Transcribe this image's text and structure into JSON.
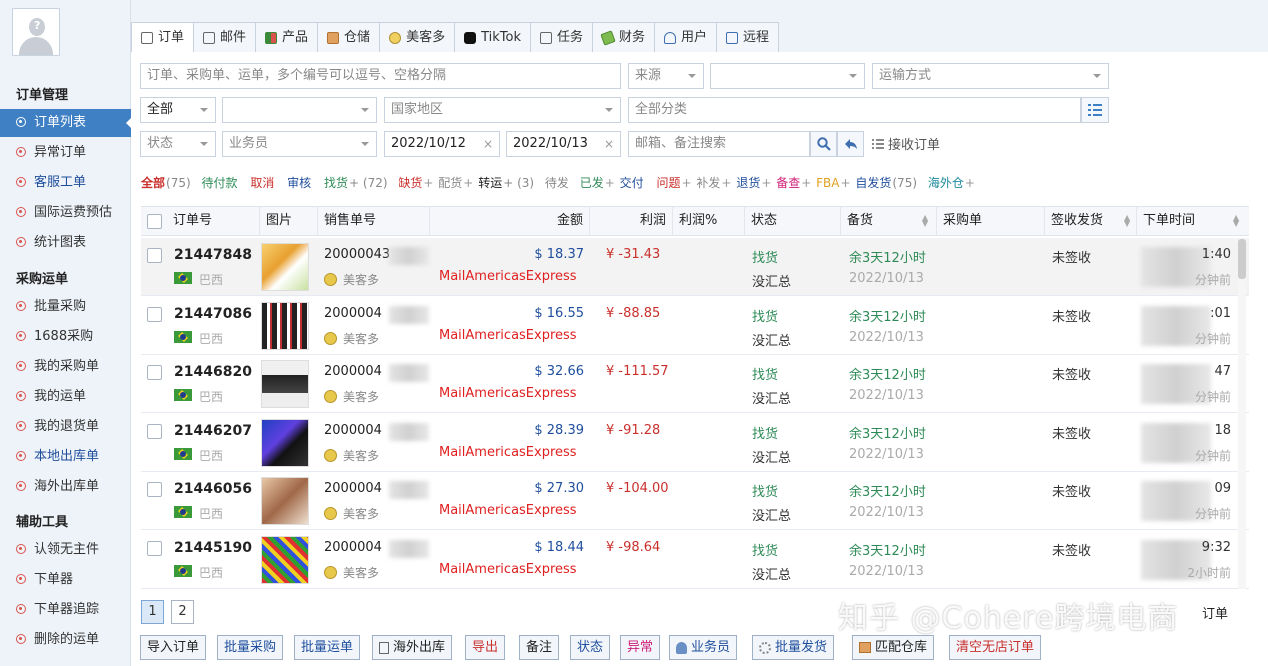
{
  "sidebar": {
    "sections": [
      {
        "title": "订单管理",
        "items": [
          "订单列表",
          "异常订单",
          "客服工单",
          "国际运费预估",
          "统计图表"
        ]
      },
      {
        "title": "采购运单",
        "items": [
          "批量采购",
          "1688采购",
          "我的采购单",
          "我的运单",
          "我的退货单",
          "本地出库单",
          "海外出库单"
        ]
      },
      {
        "title": "辅助工具",
        "items": [
          "认领无主件",
          "下单器",
          "下单器追踪",
          "删除的运单"
        ]
      }
    ]
  },
  "tabs": [
    {
      "label": "订单",
      "icon": "document-icon"
    },
    {
      "label": "邮件",
      "icon": "mail-icon"
    },
    {
      "label": "产品",
      "icon": "grid-icon"
    },
    {
      "label": "仓储",
      "icon": "box-icon"
    },
    {
      "label": "美客多",
      "icon": "handshake-icon"
    },
    {
      "label": "TikTok",
      "icon": "tiktok-icon"
    },
    {
      "label": "任务",
      "icon": "task-icon"
    },
    {
      "label": "财务",
      "icon": "money-icon"
    },
    {
      "label": "用户",
      "icon": "user-icon"
    },
    {
      "label": "远程",
      "icon": "monitor-icon"
    }
  ],
  "filters": {
    "search_placeholder": "订单、采购单、运单，多个编号可以逗号、空格分隔",
    "source": "来源",
    "shipping": "运输方式",
    "all": "全部",
    "country": "国家地区",
    "category": "全部分类",
    "status": "状态",
    "salesman": "业务员",
    "date_from": "2022/10/12",
    "date_to": "2022/10/13",
    "remark_placeholder": "邮箱、备注搜索",
    "receive_orders": "接收订单"
  },
  "status_tabs": {
    "all": "全部",
    "all_count": "(75)",
    "pending_pay": "待付款",
    "cancel": "取消",
    "review": "审核",
    "find_goods": "找货",
    "find_goods_count": "+ (72)",
    "short": "缺货",
    "allocate": "配货",
    "transfer": "转运",
    "transfer_count": "+ (3)",
    "to_ship": "待发",
    "shipped": "已发",
    "delivered": "交付",
    "problem": "问题",
    "reship": "补发",
    "return": "退货",
    "stock": "备查",
    "fba": "FBA",
    "self_ship": "自发货",
    "self_ship_count": "(75)",
    "overseas": "海外仓",
    "plus": "+"
  },
  "table": {
    "headers": [
      "订单号",
      "图片",
      "销售单号",
      "金额",
      "利润",
      "利润%",
      "状态",
      "备货",
      "采购单",
      "签收发货",
      "下单时间"
    ],
    "rows": [
      {
        "id": "21447848",
        "country": "巴西",
        "sale": "20000043",
        "shop": "美客多",
        "carrier": "MailAmericasExpress",
        "amount": "$ 18.37",
        "profit": "¥ -31.43",
        "state": "找货",
        "state2": "没汇总",
        "stock": "余3天12小时",
        "date": "2022/10/13",
        "sign": "未签收",
        "time": "1:40",
        "ago": "分钟前"
      },
      {
        "id": "21447086",
        "country": "巴西",
        "sale": "2000004",
        "shop": "美客多",
        "carrier": "MailAmericasExpress",
        "amount": "$ 16.55",
        "profit": "¥ -88.85",
        "state": "找货",
        "state2": "没汇总",
        "stock": "余3天12小时",
        "date": "2022/10/13",
        "sign": "未签收",
        "time": ":01",
        "ago": "分钟前"
      },
      {
        "id": "21446820",
        "country": "巴西",
        "sale": "2000004",
        "shop": "美客多",
        "carrier": "MailAmericasExpress",
        "amount": "$ 32.66",
        "profit": "¥ -111.57",
        "state": "找货",
        "state2": "没汇总",
        "stock": "余3天12小时",
        "date": "2022/10/13",
        "sign": "未签收",
        "time": "47",
        "ago": "分钟前"
      },
      {
        "id": "21446207",
        "country": "巴西",
        "sale": "2000004",
        "shop": "美客多",
        "carrier": "MailAmericasExpress",
        "amount": "$ 28.39",
        "profit": "¥ -91.28",
        "state": "找货",
        "state2": "没汇总",
        "stock": "余3天12小时",
        "date": "2022/10/13",
        "sign": "未签收",
        "time": "18",
        "ago": "分钟前"
      },
      {
        "id": "21446056",
        "country": "巴西",
        "sale": "2000004",
        "shop": "美客多",
        "carrier": "MailAmericasExpress",
        "amount": "$ 27.30",
        "profit": "¥ -104.00",
        "state": "找货",
        "state2": "没汇总",
        "stock": "余3天12小时",
        "date": "2022/10/13",
        "sign": "未签收",
        "time": "09",
        "ago": "分钟前"
      },
      {
        "id": "21445190",
        "country": "巴西",
        "sale": "2000004",
        "shop": "美客多",
        "carrier": "MailAmericasExpress",
        "amount": "$ 18.44",
        "profit": "¥ -98.64",
        "state": "找货",
        "state2": "没汇总",
        "stock": "余3天12小时",
        "date": "2022/10/13",
        "sign": "未签收",
        "time": "9:32",
        "ago": "2小时前"
      }
    ]
  },
  "pager": {
    "pages": [
      "1",
      "2"
    ],
    "info": "订单"
  },
  "watermark": "知乎 @Cohere跨境电商",
  "bottom_buttons": [
    {
      "label": "导入订单",
      "style": "dark"
    },
    {
      "label": "批量采购",
      "style": "blue"
    },
    {
      "label": "批量运单",
      "style": "blue"
    },
    {
      "label": "海外出库",
      "style": "dark"
    },
    {
      "label": "导出",
      "style": "red"
    },
    {
      "label": "备注",
      "style": "dark"
    },
    {
      "label": "状态",
      "style": "blue"
    },
    {
      "label": "异常",
      "style": "pink"
    },
    {
      "label": "业务员",
      "style": "blue"
    },
    {
      "label": "批量发货",
      "style": "blue"
    },
    {
      "label": "匹配仓库",
      "style": "dark"
    },
    {
      "label": "清空无店订单",
      "style": "red"
    }
  ],
  "colors": {
    "accent": "#3f7fc4",
    "green": "#2e8b57",
    "red": "#c9302c",
    "blue": "#1f4e9c"
  }
}
